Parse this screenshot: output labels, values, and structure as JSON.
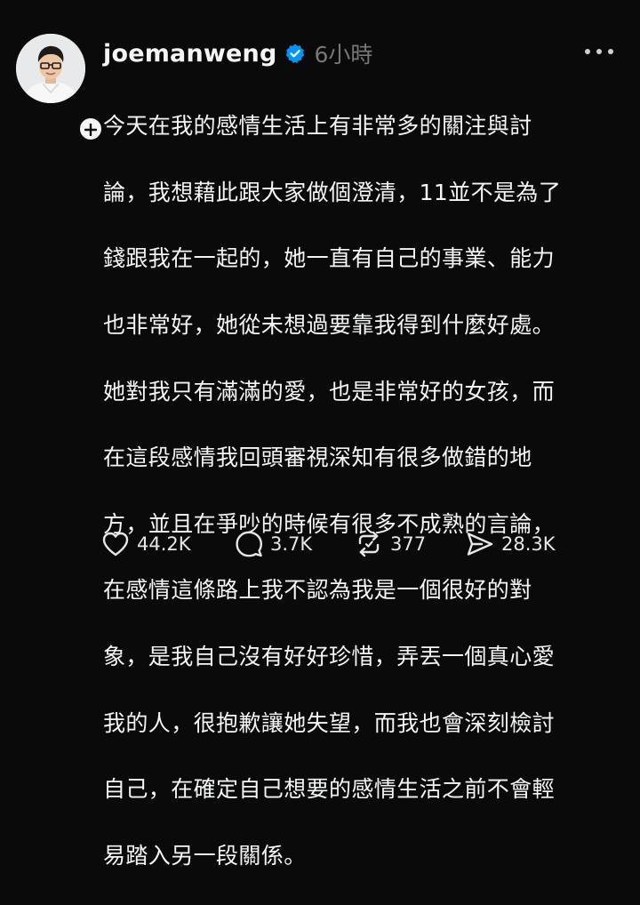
{
  "author": {
    "username": "joemanweng",
    "verified": true,
    "timestamp": "6小時"
  },
  "post": {
    "lines": [
      "今天在我的感情生活上有非常多的關注與討",
      "論，我想藉此跟大家做個澄清，11並不是為了",
      "錢跟我在一起的，她一直有自己的事業、能力",
      "也非常好，她從未想過要靠我得到什麼好處。",
      "她對我只有滿滿的愛，也是非常好的女孩，而",
      "在這段感情我回頭審視深知有很多做錯的地",
      "方，並且在爭吵的時候有很多不成熟的言論，",
      "在感情這條路上我不認為我是一個很好的對",
      "象，是我自己沒有好好珍惜，弄丟一個真心愛",
      "我的人，很抱歉讓她失望，而我也會深刻檢討",
      "自己，在確定自己想要的感情生活之前不會輕",
      "易踏入另一段關係。"
    ]
  },
  "stats": {
    "likes": "44.2K",
    "replies": "3.7K",
    "reposts": "377",
    "shares": "28.3K"
  },
  "icons": {
    "follow": "plus-icon",
    "verified": "verified-badge-icon",
    "more": "more-options-icon",
    "like": "heart-icon",
    "reply": "comment-icon",
    "repost": "repost-icon",
    "share": "send-icon"
  },
  "colors": {
    "background": "#0a0a0a",
    "text": "#f3f5f7",
    "muted": "#777777",
    "verified": "#0095f6"
  }
}
